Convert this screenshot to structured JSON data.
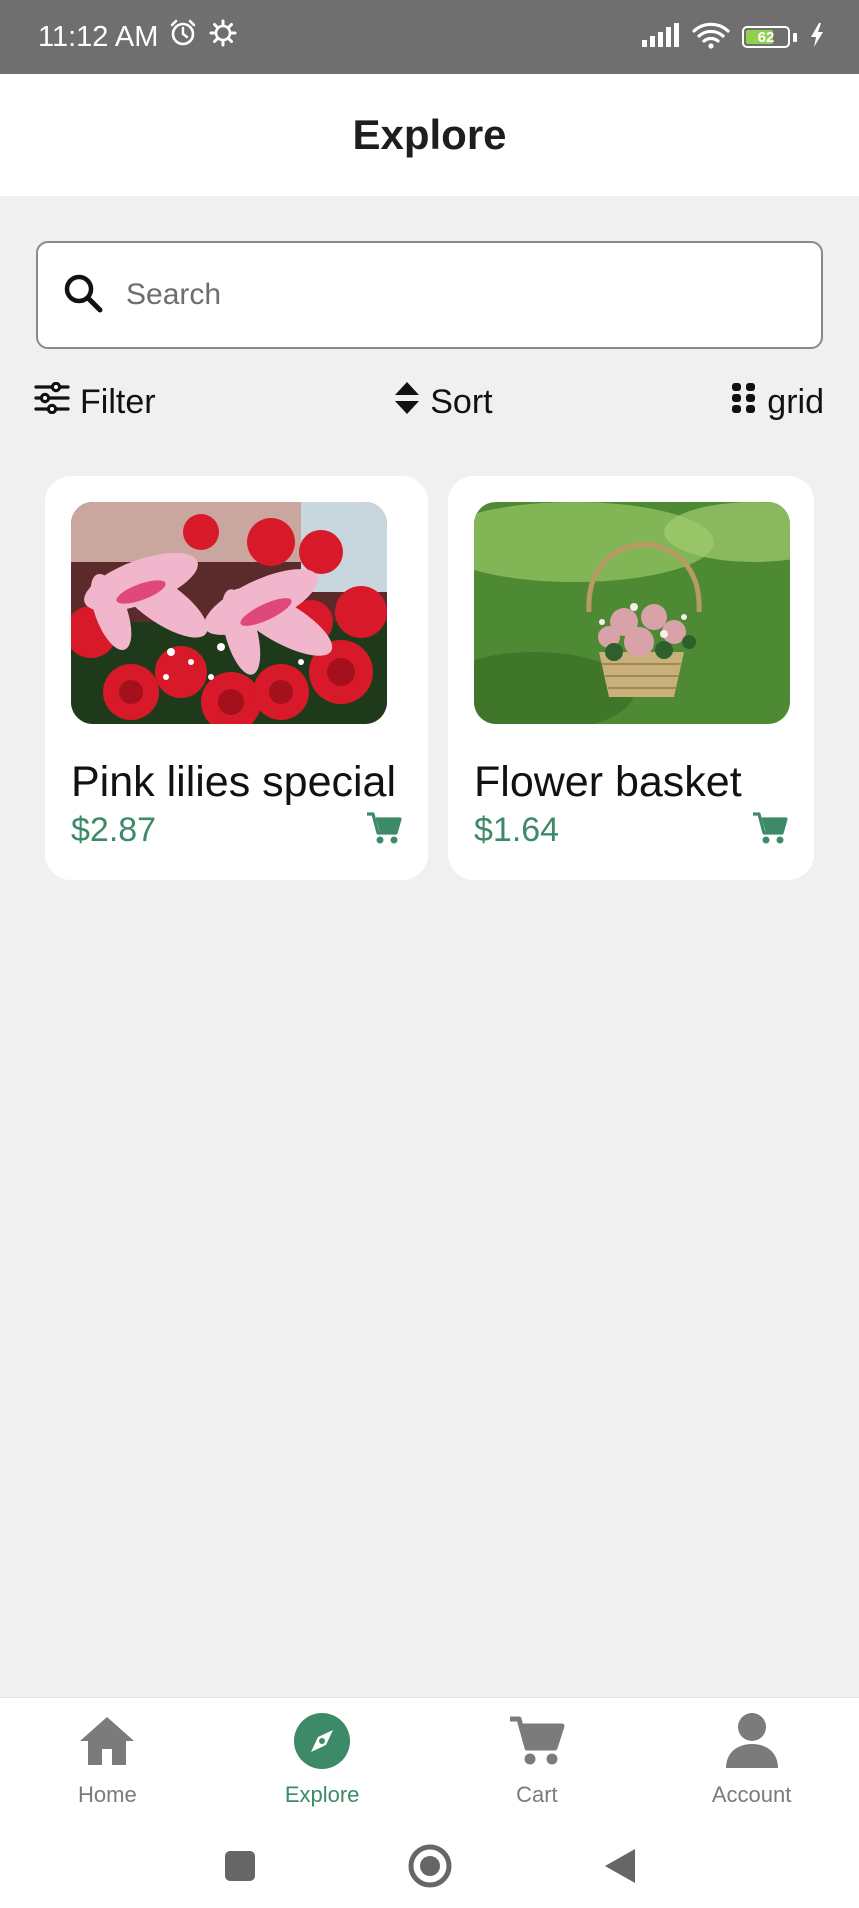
{
  "status_bar": {
    "time": "11:12 AM",
    "battery_level": "62",
    "icons": [
      "alarm-icon",
      "settings-icon",
      "signal-icon",
      "wifi-icon",
      "battery-icon",
      "charging-icon"
    ]
  },
  "header": {
    "title": "Explore"
  },
  "search": {
    "placeholder": "Search",
    "value": ""
  },
  "controls": {
    "filter_label": "Filter",
    "sort_label": "Sort",
    "view_label": "grid"
  },
  "products": [
    {
      "name": "Pink lilies special",
      "price": "$2.87",
      "image": "pink-lilies-red-roses-photo"
    },
    {
      "name": "Flower basket",
      "price": "$1.64",
      "image": "flower-basket-on-grass-photo"
    }
  ],
  "bottom_nav": {
    "items": [
      {
        "label": "Home",
        "icon": "home-icon",
        "active": false
      },
      {
        "label": "Explore",
        "icon": "compass-icon",
        "active": true
      },
      {
        "label": "Cart",
        "icon": "cart-icon",
        "active": false
      },
      {
        "label": "Account",
        "icon": "account-icon",
        "active": false
      }
    ]
  },
  "colors": {
    "accent": "#3d8a68",
    "status_bar": "#6f6f6f",
    "background": "#f0f0f0",
    "inactive_nav": "#7b7b7b"
  }
}
